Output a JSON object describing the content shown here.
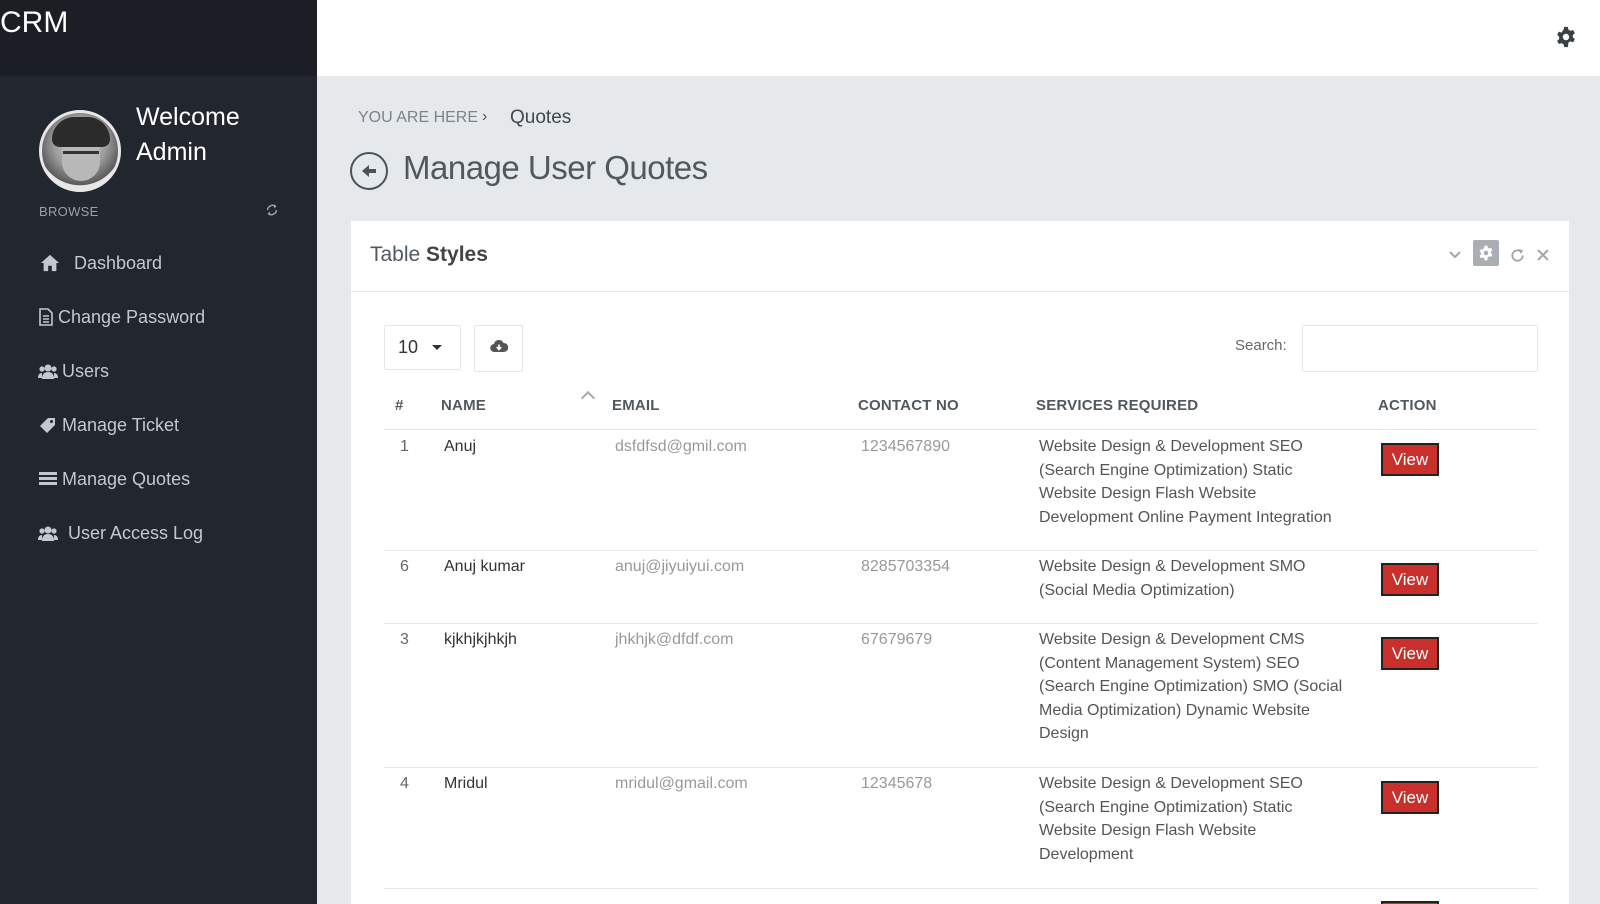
{
  "app": {
    "brand": "CRM"
  },
  "user": {
    "welcome_line1": "Welcome",
    "welcome_line2": "Admin"
  },
  "sidebar": {
    "browse_label": "BROWSE",
    "items": [
      {
        "label": "Dashboard",
        "icon": "home-icon"
      },
      {
        "label": "Change Password",
        "icon": "file-icon"
      },
      {
        "label": "Users",
        "icon": "users-icon"
      },
      {
        "label": "Manage Ticket",
        "icon": "tag-icon"
      },
      {
        "label": "Manage Quotes",
        "icon": "list-icon"
      },
      {
        "label": "User Access Log",
        "icon": "users-icon"
      }
    ]
  },
  "breadcrumb": {
    "here": "YOU ARE HERE",
    "separator": "›",
    "current": "Quotes"
  },
  "page": {
    "title": "Manage User Quotes"
  },
  "panel": {
    "title_light": "Table",
    "title_bold": "Styles",
    "page_length": "10",
    "search_label": "Search:",
    "search_value": ""
  },
  "table": {
    "headers": {
      "id": "#",
      "name": "NAME",
      "email": "EMAIL",
      "contact": "CONTACT NO",
      "services": "SERVICES REQUIRED",
      "action": "ACTION"
    },
    "view_label": "View",
    "rows": [
      {
        "id": "1",
        "name": "Anuj",
        "email": "dsfdfsd@gmil.com",
        "contact": "1234567890",
        "services": "Website Design & Development SEO (Search Engine Optimization) Static Website Design Flash Website Development Online Payment Integration"
      },
      {
        "id": "6",
        "name": "Anuj kumar",
        "email": "anuj@jiyuiyui.com",
        "contact": "8285703354",
        "services": "Website Design & Development SMO (Social Media Optimization)"
      },
      {
        "id": "3",
        "name": "kjkhjkjhkjh",
        "email": "jhkhjk@dfdf.com",
        "contact": "67679679",
        "services": "Website Design & Development CMS (Content Management System) SEO (Search Engine Optimization) SMO (Social Media Optimization) Dynamic Website Design"
      },
      {
        "id": "4",
        "name": "Mridul",
        "email": "mridul@gmail.com",
        "contact": "12345678",
        "services": "Website Design & Development SEO (Search Engine Optimization) Static Website Design Flash Website Development"
      }
    ]
  },
  "colors": {
    "sidebar": "#22262e",
    "accent_button": "#c9302c",
    "background": "#e5e9ec"
  }
}
